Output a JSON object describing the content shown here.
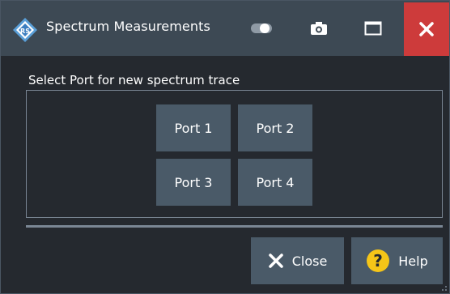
{
  "window": {
    "title": "Spectrum Measurements",
    "titlebar_buttons": [
      "toggle-icon",
      "camera-icon",
      "maximize-icon",
      "close-icon"
    ]
  },
  "group": {
    "label": "Select Port for new spectrum trace",
    "ports": [
      "Port 1",
      "Port 2",
      "Port 3",
      "Port 4"
    ]
  },
  "actions": {
    "close_label": "Close",
    "help_label": "Help"
  },
  "colors": {
    "background": "#25292f",
    "titlebar": "#3d4954",
    "button": "#4a5a68",
    "close_red": "#cd3b3b",
    "help_yellow": "#f5c518",
    "border": "#7a8694"
  }
}
